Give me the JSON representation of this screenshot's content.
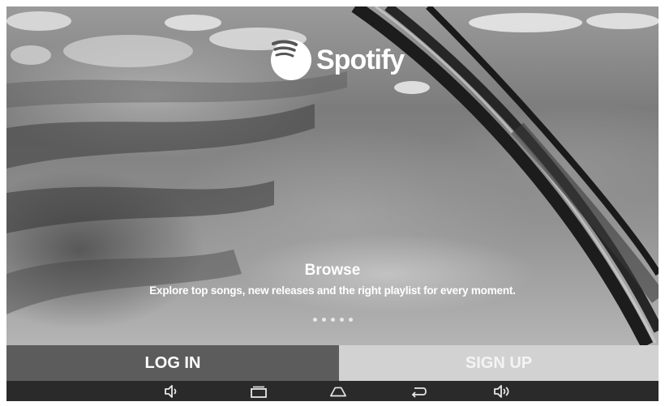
{
  "app": {
    "name": "Spotify"
  },
  "slide": {
    "title": "Browse",
    "description": "Explore top songs, new releases and the right playlist for every moment.",
    "dot_count": 5
  },
  "buttons": {
    "login_label": "LOG IN",
    "signup_label": "SIGN UP"
  },
  "navbar": {
    "icons": [
      "volume-down-icon",
      "recent-apps-icon",
      "home-icon",
      "back-icon",
      "volume-up-icon"
    ]
  },
  "colors": {
    "login_bg": "#5c5c5c",
    "signup_bg": "#d2d2d2",
    "navbar_bg": "#2a2a2a"
  }
}
